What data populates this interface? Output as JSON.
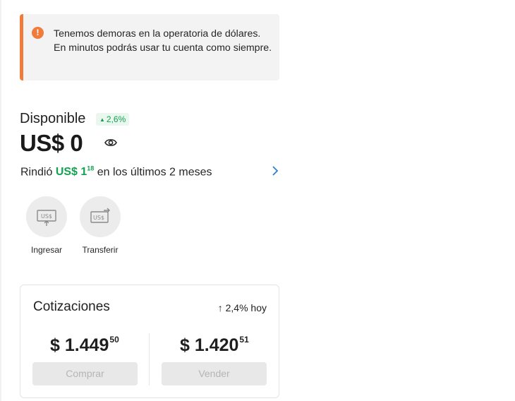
{
  "alert": {
    "message": "Tenemos demoras en la operatoria de dólares. En minutos podrás usar tu cuenta como siempre.",
    "icon": "exclamation-circle-icon",
    "accent_color": "#f07c3c"
  },
  "balance": {
    "label": "Disponible",
    "change": "2,6%",
    "amount": "US$ 0",
    "positive_color": "#11a350"
  },
  "yield": {
    "prefix": "Rindió",
    "amount": "US$ 1",
    "cents": "18",
    "suffix": "en los últimos 2 meses"
  },
  "actions": [
    {
      "label": "Ingresar",
      "icon": "deposit-dollar-icon"
    },
    {
      "label": "Transferir",
      "icon": "transfer-dollar-icon"
    }
  ],
  "quotes": {
    "title": "Cotizaciones",
    "change_today": "↑ 2,4% hoy",
    "buy": {
      "price": "$ 1.449",
      "cents": "50",
      "button": "Comprar"
    },
    "sell": {
      "price": "$ 1.420",
      "cents": "51",
      "button": "Vender"
    }
  }
}
